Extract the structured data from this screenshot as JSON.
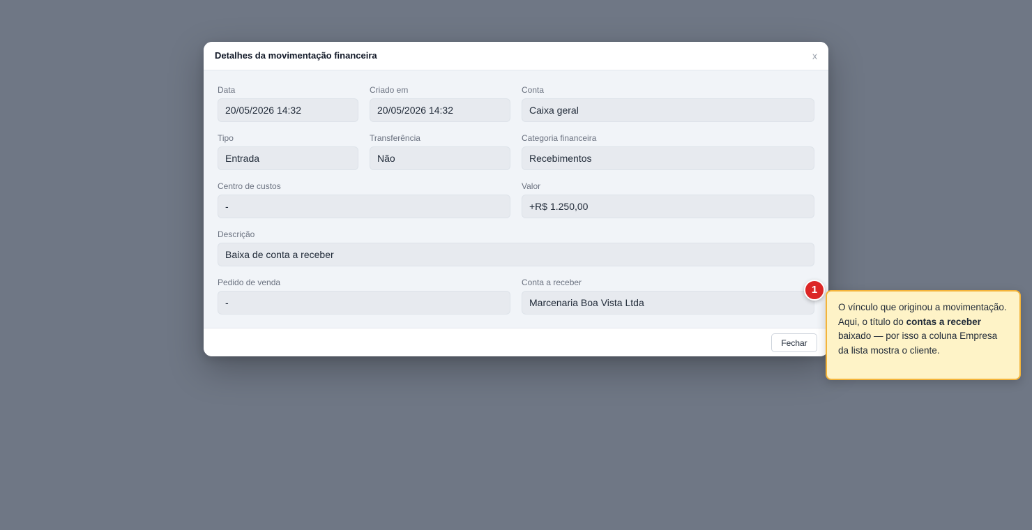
{
  "modal": {
    "title": "Detalhes da movimentação financeira",
    "close_glyph": "x",
    "close_button_label": "Fechar"
  },
  "fields": {
    "data": {
      "label": "Data",
      "value": "20/05/2026 14:32"
    },
    "criado_em": {
      "label": "Criado em",
      "value": "20/05/2026 14:32"
    },
    "conta": {
      "label": "Conta",
      "value": "Caixa geral"
    },
    "tipo": {
      "label": "Tipo",
      "value": "Entrada"
    },
    "transferencia": {
      "label": "Transferência",
      "value": "Não"
    },
    "categoria": {
      "label": "Categoria financeira",
      "value": "Recebimentos"
    },
    "centro_custos": {
      "label": "Centro de custos",
      "value": "-"
    },
    "valor": {
      "label": "Valor",
      "value": "+R$ 1.250,00"
    },
    "descricao": {
      "label": "Descrição",
      "value": "Baixa de conta a receber"
    },
    "pedido_venda": {
      "label": "Pedido de venda",
      "value": "-"
    },
    "conta_receber": {
      "label": "Conta a receber",
      "value": "Marcenaria Boa Vista Ltda"
    }
  },
  "annotation": {
    "number": "1",
    "text_before": "O vínculo que originou a movimentação. Aqui, o título do ",
    "text_bold": "contas a receber",
    "text_after": " baixado — por isso a coluna Empresa da lista mostra o cliente."
  },
  "colors": {
    "overlay": "#6f7785",
    "marker": "#dc2626",
    "callout_bg": "#fef3c7",
    "callout_border": "#f4b43a"
  }
}
